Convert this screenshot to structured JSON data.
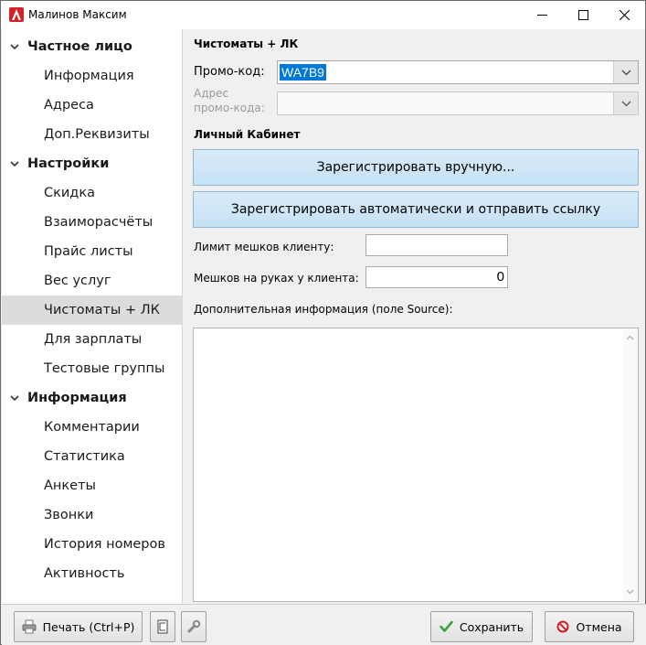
{
  "window": {
    "title": "Малинов Максим"
  },
  "sidebar": {
    "groups": [
      {
        "label": "Частное лицо",
        "items": [
          "Информация",
          "Адреса",
          "Доп.Реквизиты"
        ]
      },
      {
        "label": "Настройки",
        "items": [
          "Скидка",
          "Взаиморасчёты",
          "Прайс листы",
          "Вес услуг",
          "Чистоматы + ЛК",
          "Для зарплаты",
          "Тестовые группы"
        ]
      },
      {
        "label": "Информация",
        "items": [
          "Комментарии",
          "Статистика",
          "Анкеты",
          "Звонки",
          "История номеров",
          "Активность"
        ]
      }
    ],
    "selected": "Чистоматы + ЛК"
  },
  "main": {
    "section_title": "Чистоматы + ЛК",
    "promo_label": "Промо-код:",
    "promo_value": "WA7B9",
    "promo_address_label_1": "Адрес",
    "promo_address_label_2": "промо-кода:",
    "promo_address_value": "",
    "cabinet_title": "Личный Кабинет",
    "register_manual_button": "Зарегистрировать вручную...",
    "register_auto_button": "Зарегистрировать автоматически и отправить ссылку",
    "bag_limit_label": "Лимит мешков клиенту:",
    "bag_limit_value": "",
    "bags_on_hand_label": "Мешков на руках у клиента:",
    "bags_on_hand_value": "0",
    "extra_info_label": "Дополнительная информация (поле Source):",
    "extra_info_value": ""
  },
  "footer": {
    "print_button": "Печать (Ctrl+P)",
    "save_button": "Сохранить",
    "cancel_button": "Отмена"
  },
  "colors": {
    "accent_blue": "#0078d7",
    "selected_row": "#dcdcdc",
    "primary_button": "#c5e1f5",
    "save_check": "#3aa53a",
    "cancel_icon": "#d0202a"
  },
  "icons": {
    "app": "app-logo-icon",
    "minimize": "minimize-icon",
    "maximize": "maximize-icon",
    "close": "close-icon",
    "printer": "printer-icon",
    "document": "document-icon",
    "wrench": "wrench-icon",
    "check": "check-icon",
    "cancel": "no-entry-icon"
  }
}
